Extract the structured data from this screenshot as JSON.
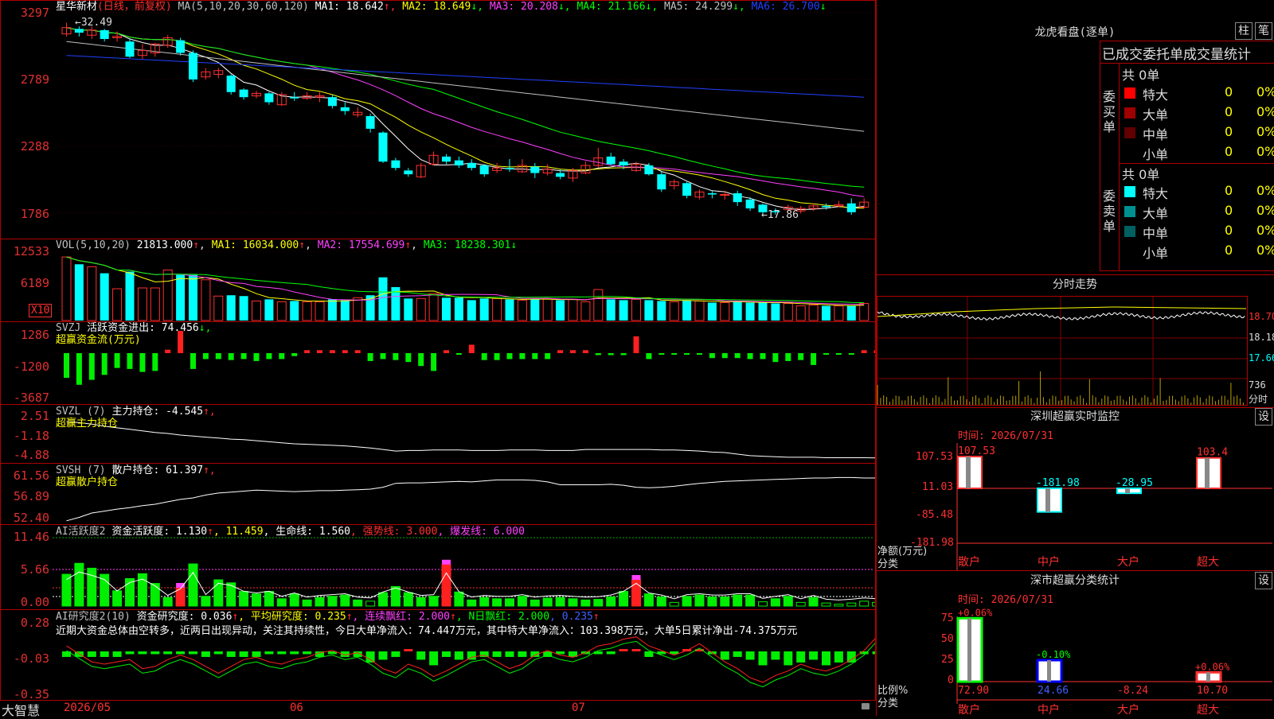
{
  "main": {
    "ticker": "星华新材",
    "period": "(日线，前复权)",
    "ma_label": "MA(5,10,20,30,60,120)",
    "ma_values": [
      {
        "label": "MA1: 18.642",
        "arrow": "↑",
        "color": "#ffffff"
      },
      {
        "label": "MA2: 18.649",
        "arrow": "↓",
        "color": "#ffff00"
      },
      {
        "label": "MA3: 20.208",
        "arrow": "↓",
        "color": "#ff40ff"
      },
      {
        "label": "MA4: 21.166",
        "arrow": "↓",
        "color": "#00ff00"
      },
      {
        "label": "MA5: 24.299",
        "arrow": "↓",
        "color": "#c0c0c0"
      },
      {
        "label": "MA6: 26.700",
        "arrow": "↓",
        "color": "#2040ff"
      }
    ],
    "y_labels": [
      "3297",
      "2789",
      "2288",
      "1786"
    ],
    "high_mark": "←32.49",
    "low_mark": "←17.86",
    "chart_data": {
      "type": "candlestick",
      "title": "星华新材 (日线，前复权)",
      "x_labels": [
        "2026/05",
        "06",
        "07"
      ],
      "ylim": [
        17.3,
        32.9
      ],
      "candles": [
        {
          "o": 31.6,
          "c": 32.1,
          "h": 32.49,
          "l": 31.4
        },
        {
          "o": 32.0,
          "c": 31.7,
          "h": 32.2,
          "l": 31.4
        },
        {
          "o": 31.5,
          "c": 31.9,
          "h": 32.2,
          "l": 31.2
        },
        {
          "o": 31.9,
          "c": 31.2,
          "h": 32.0,
          "l": 31.0
        },
        {
          "o": 31.3,
          "c": 31.4,
          "h": 31.8,
          "l": 31.0
        },
        {
          "o": 31.0,
          "c": 29.8,
          "h": 31.2,
          "l": 29.7
        },
        {
          "o": 29.9,
          "c": 30.3,
          "h": 30.8,
          "l": 29.6
        },
        {
          "o": 30.1,
          "c": 30.8,
          "h": 30.9,
          "l": 29.8
        },
        {
          "o": 30.7,
          "c": 31.3,
          "h": 31.5,
          "l": 30.5
        },
        {
          "o": 31.1,
          "c": 30.1,
          "h": 31.3,
          "l": 29.9
        },
        {
          "o": 30.1,
          "c": 28.0,
          "h": 30.3,
          "l": 27.8
        },
        {
          "o": 28.2,
          "c": 28.6,
          "h": 28.9,
          "l": 28.0
        },
        {
          "o": 28.4,
          "c": 28.7,
          "h": 28.9,
          "l": 28.1
        },
        {
          "o": 28.3,
          "c": 27.0,
          "h": 28.4,
          "l": 26.8
        },
        {
          "o": 27.2,
          "c": 26.6,
          "h": 27.3,
          "l": 26.4
        },
        {
          "o": 26.7,
          "c": 26.9,
          "h": 27.1,
          "l": 26.5
        },
        {
          "o": 26.9,
          "c": 26.2,
          "h": 27.0,
          "l": 26.0
        },
        {
          "o": 26.0,
          "c": 26.8,
          "h": 27.0,
          "l": 25.9
        },
        {
          "o": 26.6,
          "c": 26.5,
          "h": 27.0,
          "l": 26.3
        },
        {
          "o": 26.5,
          "c": 26.7,
          "h": 27.0,
          "l": 26.4
        },
        {
          "o": 26.6,
          "c": 26.7,
          "h": 27.0,
          "l": 26.2
        },
        {
          "o": 26.6,
          "c": 25.9,
          "h": 26.8,
          "l": 25.7
        },
        {
          "o": 25.8,
          "c": 25.5,
          "h": 26.2,
          "l": 25.2
        },
        {
          "o": 25.2,
          "c": 25.4,
          "h": 25.8,
          "l": 25.0
        },
        {
          "o": 25.1,
          "c": 24.1,
          "h": 25.3,
          "l": 23.8
        },
        {
          "o": 23.8,
          "c": 21.5,
          "h": 23.9,
          "l": 21.4
        },
        {
          "o": 21.6,
          "c": 21.0,
          "h": 21.8,
          "l": 20.8
        },
        {
          "o": 20.8,
          "c": 20.5,
          "h": 21.0,
          "l": 20.3
        },
        {
          "o": 20.3,
          "c": 21.2,
          "h": 21.4,
          "l": 20.2
        },
        {
          "o": 21.3,
          "c": 22.0,
          "h": 22.3,
          "l": 21.2
        },
        {
          "o": 21.9,
          "c": 21.5,
          "h": 22.1,
          "l": 21.3
        },
        {
          "o": 21.6,
          "c": 21.2,
          "h": 21.9,
          "l": 21.0
        },
        {
          "o": 21.4,
          "c": 21.0,
          "h": 21.7,
          "l": 20.8
        },
        {
          "o": 21.2,
          "c": 20.5,
          "h": 21.3,
          "l": 20.3
        },
        {
          "o": 20.8,
          "c": 21.0,
          "h": 21.4,
          "l": 20.6
        },
        {
          "o": 21.0,
          "c": 20.9,
          "h": 21.7,
          "l": 20.7
        },
        {
          "o": 20.7,
          "c": 21.2,
          "h": 21.7,
          "l": 20.6
        },
        {
          "o": 21.1,
          "c": 20.6,
          "h": 21.4,
          "l": 20.2
        },
        {
          "o": 20.6,
          "c": 20.9,
          "h": 21.3,
          "l": 20.4
        },
        {
          "o": 20.6,
          "c": 20.3,
          "h": 20.9,
          "l": 20.1
        },
        {
          "o": 20.2,
          "c": 20.8,
          "h": 21.0,
          "l": 19.9
        },
        {
          "o": 20.6,
          "c": 21.2,
          "h": 21.5,
          "l": 20.5
        },
        {
          "o": 21.2,
          "c": 21.8,
          "h": 22.6,
          "l": 21.0
        },
        {
          "o": 21.9,
          "c": 21.3,
          "h": 22.2,
          "l": 21.2
        },
        {
          "o": 21.5,
          "c": 21.2,
          "h": 21.7,
          "l": 20.9
        },
        {
          "o": 20.8,
          "c": 21.3,
          "h": 21.5,
          "l": 20.7
        },
        {
          "o": 21.2,
          "c": 20.5,
          "h": 21.4,
          "l": 20.4
        },
        {
          "o": 20.5,
          "c": 19.3,
          "h": 20.7,
          "l": 19.1
        },
        {
          "o": 19.6,
          "c": 19.9,
          "h": 20.1,
          "l": 19.3
        },
        {
          "o": 19.8,
          "c": 18.8,
          "h": 19.9,
          "l": 18.6
        },
        {
          "o": 18.7,
          "c": 19.1,
          "h": 19.3,
          "l": 18.5
        },
        {
          "o": 19.0,
          "c": 18.9,
          "h": 19.2,
          "l": 18.6
        },
        {
          "o": 18.9,
          "c": 18.9,
          "h": 19.2,
          "l": 18.5
        },
        {
          "o": 19.0,
          "c": 18.3,
          "h": 19.2,
          "l": 18.0
        },
        {
          "o": 18.5,
          "c": 17.8,
          "h": 18.7,
          "l": 17.6
        },
        {
          "o": 18.1,
          "c": 17.5,
          "h": 18.2,
          "l": 17.3
        },
        {
          "o": 17.6,
          "c": 17.5,
          "h": 17.8,
          "l": 17.3
        },
        {
          "o": 17.7,
          "c": 17.9,
          "h": 18.1,
          "l": 17.6
        },
        {
          "o": 17.6,
          "c": 17.8,
          "h": 18.0,
          "l": 17.4
        },
        {
          "o": 17.8,
          "c": 18.0,
          "h": 18.2,
          "l": 17.6
        },
        {
          "o": 18.0,
          "c": 17.9,
          "h": 18.2,
          "l": 17.7
        },
        {
          "o": 18.0,
          "c": 18.1,
          "h": 18.4,
          "l": 17.9
        },
        {
          "o": 18.2,
          "c": 17.5,
          "h": 18.6,
          "l": 17.3
        },
        {
          "o": 17.9,
          "c": 18.3,
          "h": 18.6,
          "l": 17.8
        }
      ]
    }
  },
  "vol": {
    "header": "VOL(5,10,20)",
    "val": "21813.000",
    "ma1": "MA1: 16034.000",
    "ma2": "MA2: 17554.699",
    "ma3": "MA3: 18238.301",
    "y_labels": [
      "12533",
      "6189"
    ],
    "unit": "X10",
    "chart_data": {
      "type": "bar",
      "unit": "X10",
      "values": [
        780,
        690,
        660,
        580,
        390,
        600,
        400,
        400,
        620,
        560,
        560,
        500,
        300,
        310,
        300,
        240,
        260,
        230,
        240,
        230,
        230,
        260,
        250,
        280,
        310,
        530,
        410,
        270,
        270,
        330,
        280,
        280,
        250,
        270,
        270,
        260,
        250,
        260,
        270,
        250,
        260,
        230,
        380,
        260,
        250,
        260,
        250,
        240,
        230,
        250,
        240,
        220,
        220,
        230,
        220,
        220,
        210,
        210,
        180,
        190,
        180,
        180,
        180,
        210
      ]
    }
  },
  "svzj": {
    "header": "SVZJ",
    "label": "活跃资金进出: 74.456",
    "arrow": "↓,",
    "sub": "超赢资金流(万元)",
    "y_labels": [
      "1286",
      "-1200",
      "-3687"
    ],
    "chart_data": {
      "type": "bar",
      "values": [
        -2500,
        -3200,
        -2700,
        -2200,
        -1500,
        -1600,
        -1900,
        -1800,
        350,
        2250,
        -1600,
        -600,
        -600,
        -700,
        -600,
        -800,
        -600,
        -600,
        -300,
        300,
        300,
        300,
        300,
        300,
        -800,
        -600,
        -700,
        -900,
        -1300,
        -1800,
        300,
        -100,
        850,
        -700,
        -700,
        -600,
        -600,
        -600,
        -600,
        300,
        300,
        300,
        -200,
        -200,
        -200,
        1700,
        -600,
        -100,
        -100,
        -100,
        -100,
        -500,
        -500,
        -500,
        -600,
        -600,
        -900,
        -800,
        -700,
        -1200,
        -100,
        -100,
        -100,
        300,
        300,
        300
      ]
    }
  },
  "svzl": {
    "header": "SVZL (7)",
    "label": "主力持仓: -4.545",
    "arrow": "↑,",
    "sub": "超赢主力持仓",
    "y_labels": [
      "2.51",
      "-1.18",
      "-4.88"
    ],
    "chart_data": {
      "type": "line",
      "ylim": [
        -4.88,
        2.51
      ],
      "values": [
        2.51,
        2.3,
        2.0,
        1.6,
        1.3,
        1.0,
        0.7,
        0.4,
        0.2,
        -0.1,
        -0.3,
        -0.5,
        -0.7,
        -0.9,
        -1.0,
        -1.2,
        -1.4,
        -1.6,
        -1.8,
        -1.9,
        -2.0,
        -2.1,
        -2.2,
        -2.4,
        -2.6,
        -2.9,
        -3.2,
        -3.1,
        -3.1,
        -3.0,
        -3.0,
        -3.0,
        -3.1,
        -3.1,
        -3.1,
        -3.0,
        -3.0,
        -3.0,
        -3.1,
        -3.1,
        -3.1,
        -2.9,
        -2.9,
        -2.9,
        -2.9,
        -2.9,
        -2.9,
        -3.0,
        -3.0,
        -3.1,
        -3.2,
        -3.4,
        -3.5,
        -3.8,
        -4.1,
        -4.2,
        -4.3,
        -4.4,
        -4.4,
        -4.4,
        -4.5,
        -4.5,
        -4.5,
        -4.5,
        -4.545
      ]
    }
  },
  "svsh": {
    "header": "SVSH (7)",
    "label": "散户持仓: 61.397",
    "arrow": "↑,",
    "sub": "超赢散户持仓",
    "y_labels": [
      "61.56",
      "56.89",
      "52.40"
    ],
    "chart_data": {
      "type": "line",
      "ylim": [
        52.4,
        61.56
      ],
      "values": [
        52.6,
        53.3,
        54.2,
        54.6,
        55.0,
        55.3,
        55.7,
        56.0,
        56.5,
        57.0,
        57.3,
        57.9,
        58.3,
        58.5,
        58.7,
        58.9,
        58.8,
        58.7,
        58.6,
        58.7,
        58.8,
        58.8,
        58.9,
        59.0,
        59.1,
        59.5,
        60.3,
        60.4,
        60.4,
        60.5,
        60.6,
        60.7,
        60.6,
        60.8,
        61.0,
        61.0,
        61.0,
        60.9,
        60.6,
        60.0,
        60.0,
        60.0,
        60.0,
        60.1,
        59.9,
        59.5,
        59.4,
        59.5,
        59.7,
        60.0,
        60.3,
        60.5,
        60.7,
        60.8,
        60.9,
        61.0,
        61.1,
        61.2,
        61.3,
        61.4,
        61.4,
        61.5,
        61.5,
        61.4,
        61.397
      ]
    }
  },
  "ai1": {
    "header": "AI活跃度2",
    "seg1": "资金活跃度: 1.130",
    "seg1_arrow": "↑",
    "seg2": ", 11.459",
    "seg3": ", 生命线: 1.560",
    "seg4": ", 强势线: 3.000",
    "seg5": ", 爆发线: 6.000",
    "y_labels": [
      "11.46",
      "5.66",
      "0.00"
    ],
    "chart_data": {
      "type": "bar",
      "ylim": [
        0,
        11.46
      ],
      "values": [
        5.2,
        7.0,
        6.2,
        5.2,
        2.5,
        4.5,
        5.3,
        3.7,
        1.4,
        3.0,
        6.9,
        1.6,
        4.3,
        3.8,
        2.4,
        2.0,
        2.4,
        1.2,
        2.0,
        1.0,
        1.4,
        1.6,
        1.8,
        1.0,
        0.8,
        2.2,
        3.2,
        2.2,
        1.4,
        1.6,
        6.8,
        2.3,
        1.0,
        1.4,
        1.2,
        1.2,
        1.6,
        1.0,
        1.3,
        1.4,
        1.2,
        1.0,
        1.1,
        1.5,
        2.4,
        4.3,
        2.0,
        1.5,
        0.6,
        1.6,
        1.8,
        1.5,
        1.5,
        1.8,
        1.8,
        0.7,
        1.2,
        1.6,
        0.6,
        1.4,
        0.5,
        0.3,
        0.5,
        0.8,
        0.6,
        1.1
      ]
    }
  },
  "ai2": {
    "header": "AI研究度2(10)",
    "seg1": "资金研究度: 0.036",
    "seg1_arrow": "↑",
    "seg2": ", 平均研究度: 0.235",
    "seg2_arrow": "↑",
    "seg3": ", 连续飘红: 2.000",
    "seg3_arrow": "↑",
    "seg4": ", N日飘红: 2.000",
    "seg5": ", 0.235",
    "seg5_arrow": "↑",
    "text": "近期大资金总体由空转多，近两日出现异动，关注其持续性，今日大单净流入：74.447万元，其中特大单净流入：103.398万元，大单5日累计净出-74.375万元",
    "y_labels": [
      "0.28",
      "-0.03",
      "-0.35"
    ],
    "chart_data": {
      "type": "bar",
      "ylim": [
        -0.35,
        0.28
      ],
      "values": [
        -0.04,
        -0.04,
        -0.04,
        -0.04,
        -0.04,
        -0.02,
        -0.02,
        -0.02,
        -0.02,
        -0.02,
        -0.02,
        -0.04,
        -0.02,
        -0.04,
        -0.04,
        -0.04,
        -0.02,
        -0.02,
        -0.02,
        -0.02,
        -0.04,
        -0.02,
        -0.04,
        -0.04,
        -0.08,
        -0.06,
        -0.04,
        0.01,
        -0.06,
        -0.1,
        -0.04,
        -0.06,
        -0.06,
        -0.04,
        -0.04,
        -0.04,
        -0.04,
        -0.04,
        -0.04,
        -0.02,
        -0.04,
        -0.02,
        -0.02,
        -0.02,
        0.01,
        0.01,
        -0.04,
        -0.02,
        -0.02,
        0.01,
        0.01,
        -0.02,
        -0.06,
        -0.04,
        -0.06,
        -0.1,
        -0.06,
        -0.1,
        -0.08,
        -0.06,
        -0.1,
        -0.08,
        -0.08,
        -0.02,
        -0.02,
        -0.02
      ]
    }
  },
  "bottom": {
    "logo": "大智慧",
    "dates": [
      "2026/05",
      "06",
      "07"
    ]
  },
  "right": {
    "lhb_title": "龙虎看盘(逐单)",
    "btn_bar": "柱",
    "btn_pen": "笔",
    "stats_title": "已成交委托单成交量统计",
    "buy_total": "共 0单",
    "buy_side": [
      "委",
      "买",
      "单"
    ],
    "sell_total": "共 0单",
    "sell_side": [
      "委",
      "卖",
      "单"
    ],
    "buy_rows": [
      {
        "label": "特大",
        "count": "0",
        "pct": "0%",
        "color": "#ff0000"
      },
      {
        "label": "大单",
        "count": "0",
        "pct": "0%",
        "color": "#a00000"
      },
      {
        "label": "中单",
        "count": "0",
        "pct": "0%",
        "color": "#600000"
      },
      {
        "label": "小单",
        "count": "0",
        "pct": "0%",
        "color": "#000000"
      }
    ],
    "sell_rows": [
      {
        "label": "特大",
        "count": "0",
        "pct": "0%",
        "color": "#00ffff"
      },
      {
        "label": "大单",
        "count": "0",
        "pct": "0%",
        "color": "#009090"
      },
      {
        "label": "中单",
        "count": "0",
        "pct": "0%",
        "color": "#006060"
      },
      {
        "label": "小单",
        "count": "0",
        "pct": "0%",
        "color": "#000000"
      }
    ],
    "intraday_title": "分时走势",
    "intraday_prices": [
      "18.70",
      "18.18",
      "17.66"
    ],
    "intraday_vol": "736",
    "intraday_unit": "分时",
    "sz_title": "深圳超赢实时监控",
    "sz_btn": "设",
    "sz_time": "时间: 2026/07/31",
    "sz_ylabels": [
      "107.53",
      "11.03",
      "-85.48",
      "-181.98"
    ],
    "sz_axis": "净额(万元)",
    "sz_axis2": "分类",
    "sz_chart_data": {
      "type": "bar",
      "categories": [
        "散户",
        "中户",
        "大户",
        "超大"
      ],
      "values": [
        107.53,
        -181.98,
        -28.95,
        103.4
      ],
      "labels": [
        "107.53",
        "-181.98",
        "-28.95",
        "103.4"
      ]
    },
    "sm_title": "深市超赢分类统计",
    "sm_btn": "设",
    "sm_time": "时间: 2026/07/31",
    "sm_ylabels": [
      "75",
      "50",
      "25",
      "0"
    ],
    "sm_axis": "比例%",
    "sm_axis2": "分类",
    "sm_chart_data": {
      "type": "bar",
      "categories": [
        "散户",
        "中户",
        "大户",
        "超大"
      ],
      "values": [
        72.9,
        24.66,
        -8.24,
        10.7
      ],
      "changes": [
        "+0.06%",
        "-0.10%",
        "",
        "+0.06%"
      ],
      "labels": [
        "72.90",
        "24.66",
        "-8.24",
        "10.70"
      ]
    }
  }
}
